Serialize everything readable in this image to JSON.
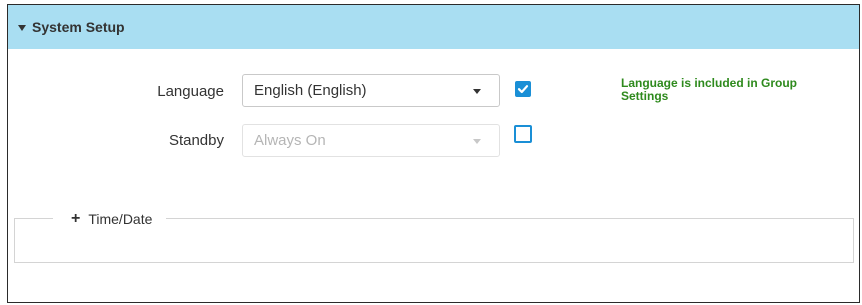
{
  "system_setup": {
    "title": "System Setup",
    "expanded": true
  },
  "language": {
    "label": "Language",
    "value": "English (English)",
    "group_included": true,
    "group_note": "Language is included in Group Settings"
  },
  "standby": {
    "label": "Standby",
    "value": "Always On",
    "disabled": true,
    "group_included": false
  },
  "time_date": {
    "title": "Time/Date",
    "expanded": false
  },
  "colors": {
    "header_bg": "#a9def2",
    "accent": "#1a8fd6",
    "note_green": "#2e8a1d"
  }
}
